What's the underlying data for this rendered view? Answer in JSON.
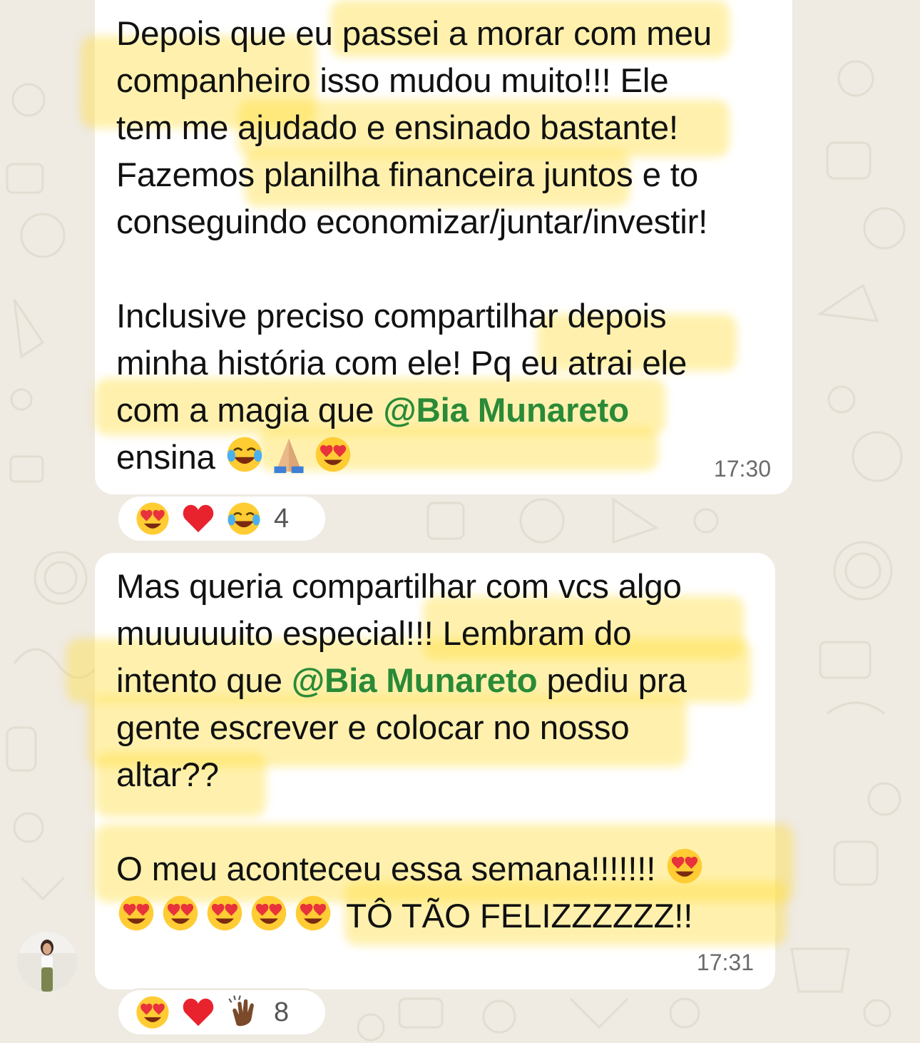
{
  "messages": [
    {
      "lines": [
        "Depois que eu passei a morar com meu",
        "companheiro isso mudou muito!!! Ele",
        "tem me ajudado e ensinado bastante!",
        "Fazemos planilha financeira juntos e to",
        "conseguindo economizar/juntar/investir!",
        "",
        "Inclusive preciso compartilhar depois",
        "minha história com ele! Pq eu atrai ele",
        "com a magia que ",
        "ensina "
      ],
      "mention": "@Bia Munareto",
      "trailing_emojis": [
        "tears-of-joy-emoji",
        "folded-hands-emoji",
        "heart-eyes-emoji"
      ],
      "time": "17:30",
      "reactions": {
        "emojis": [
          "heart-eyes-emoji",
          "red-heart-emoji",
          "tears-of-joy-emoji"
        ],
        "count": "4"
      }
    },
    {
      "lines": [
        "Mas queria compartilhar com vcs algo",
        "muuuuuito especial!!! Lembram do",
        "intento que ",
        " pediu pra",
        "gente escrever e colocar no nosso",
        "altar??",
        "",
        "O meu aconteceu essa semana!!!!!!! ",
        " TÔ TÃO FELIZZZZZZ!!"
      ],
      "mention": "@Bia Munareto",
      "time": "17:31",
      "reactions": {
        "emojis": [
          "heart-eyes-emoji",
          "red-heart-emoji",
          "clapping-hands-emoji"
        ],
        "count": "8"
      }
    }
  ],
  "colors": {
    "mention": "#2a8a37",
    "highlight": "#ffdd3c",
    "wallpaper": "#efeae2",
    "bubble": "#ffffff"
  }
}
